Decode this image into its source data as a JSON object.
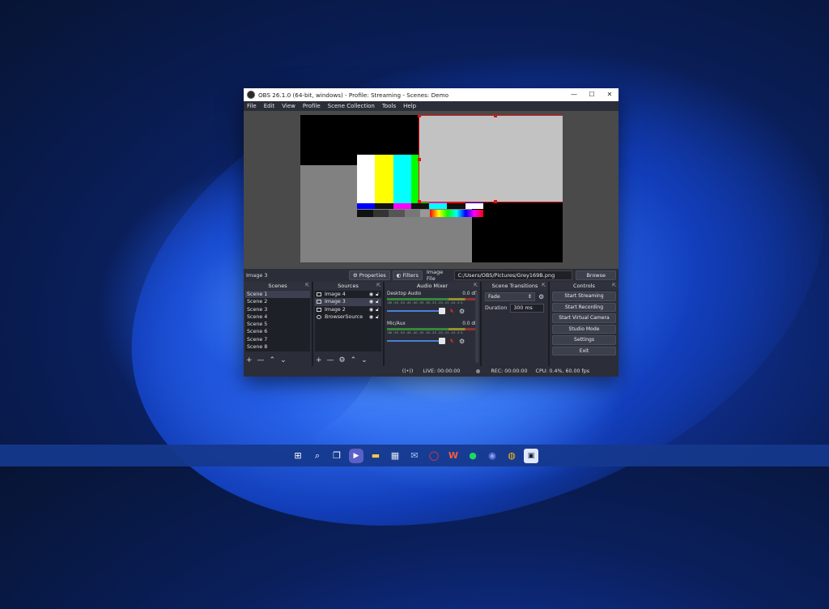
{
  "window": {
    "title": "OBS 26.1.0 (64-bit, windows) - Profile: Streaming - Scenes: Demo",
    "controls": {
      "minimize": "—",
      "maximize": "☐",
      "close": "✕"
    }
  },
  "menu": [
    "File",
    "Edit",
    "View",
    "Profile",
    "Scene Collection",
    "Tools",
    "Help"
  ],
  "property_bar": {
    "selected_source": "Image 3",
    "properties_label": "Properties",
    "filters_label": "Filters",
    "image_file_label": "Image File",
    "image_file_path": "C:/Users/OBS/Pictures/Grey169B.png",
    "browse_label": "Browse"
  },
  "scenes": {
    "title": "Scenes",
    "items": [
      "Scene 1",
      "Scene 2",
      "Scene 3",
      "Scene 4",
      "Scene 5",
      "Scene 6",
      "Scene 7",
      "Scene 8"
    ],
    "selected_index": 0,
    "toolbar": {
      "add": "+",
      "remove": "—",
      "up": "⌃",
      "down": "⌄"
    }
  },
  "sources": {
    "title": "Sources",
    "items": [
      "Image 4",
      "Image 3",
      "Image 2",
      "BrowserSource"
    ],
    "selected_index": 1,
    "toolbar": {
      "add": "+",
      "remove": "—",
      "settings": "⚙",
      "up": "⌃",
      "down": "⌄"
    }
  },
  "audio_mixer": {
    "title": "Audio Mixer",
    "channels": [
      {
        "name": "Desktop Audio",
        "level": "0.0 dB",
        "ticks": "-60 -55 -50 -45 -40 -35 -30 -25 -20 -15 -10 -5 0"
      },
      {
        "name": "Mic/Aux",
        "level": "0.0 dB",
        "ticks": "-60 -55 -50 -45 -40 -35 -30 -25 -20 -15 -10 -5 0"
      }
    ]
  },
  "transitions": {
    "title": "Scene Transitions",
    "type": "Fade",
    "duration_label": "Duration",
    "duration_value": "300 ms"
  },
  "controls": {
    "title": "Controls",
    "buttons": [
      "Start Streaming",
      "Start Recording",
      "Start Virtual Camera",
      "Studio Mode",
      "Settings",
      "Exit"
    ]
  },
  "status": {
    "live": "LIVE: 00:00:00",
    "rec": "REC: 00:00:00",
    "cpu": "CPU: 0.4%, 60.00 fps"
  },
  "colors": {
    "accent_red": "#e01212",
    "obs_bg": "#2b2e38"
  }
}
